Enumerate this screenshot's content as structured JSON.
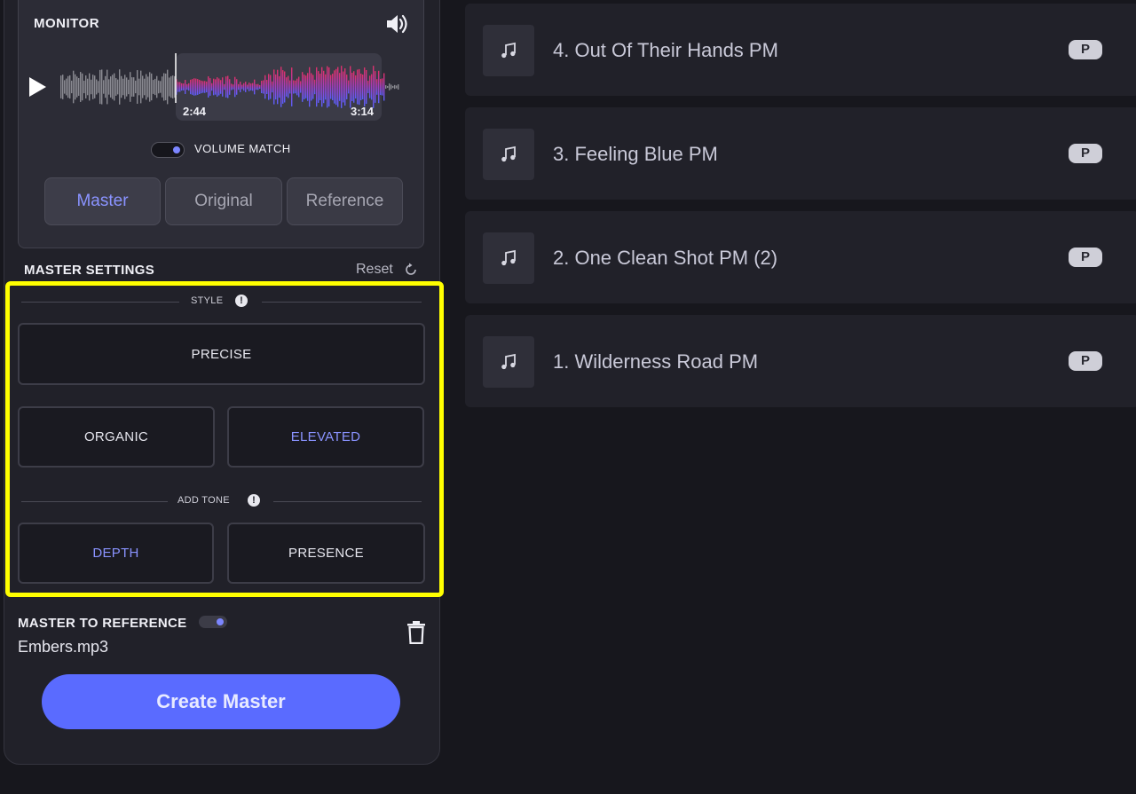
{
  "monitor": {
    "title": "MONITOR",
    "time_start": "2:44",
    "time_end": "3:14",
    "volume_match_label": "VOLUME MATCH",
    "volume_match_on": true,
    "tabs": [
      {
        "label": "Master",
        "active": true
      },
      {
        "label": "Original",
        "active": false
      },
      {
        "label": "Reference",
        "active": false
      }
    ]
  },
  "master_settings": {
    "title": "MASTER SETTINGS",
    "reset_label": "Reset",
    "style_label": "STYLE",
    "styles": [
      {
        "label": "PRECISE",
        "selected": false
      },
      {
        "label": "ORGANIC",
        "selected": false
      },
      {
        "label": "ELEVATED",
        "selected": true
      }
    ],
    "tone_label": "ADD TONE",
    "tones": [
      {
        "label": "DEPTH",
        "selected": true
      },
      {
        "label": "PRESENCE",
        "selected": false
      }
    ]
  },
  "reference": {
    "title": "MASTER TO REFERENCE",
    "enabled": true,
    "file": "Embers.mp3"
  },
  "create_button": "Create Master",
  "tracks": [
    {
      "name": "4. Out Of Their Hands PM",
      "badge": "P"
    },
    {
      "name": "3. Feeling Blue PM",
      "badge": "P"
    },
    {
      "name": "2. One Clean Shot PM (2)",
      "badge": "P"
    },
    {
      "name": "1. Wilderness Road PM",
      "badge": "P"
    }
  ],
  "colors": {
    "accent": "#7c86ff",
    "button": "#5a6bff",
    "highlight": "#ffff00",
    "wave_left": "#e0306a",
    "wave_right": "#5a60ff"
  },
  "icons": [
    "speaker-icon",
    "play-icon",
    "info-icon",
    "reset-icon",
    "trash-icon",
    "music-note-icon"
  ]
}
